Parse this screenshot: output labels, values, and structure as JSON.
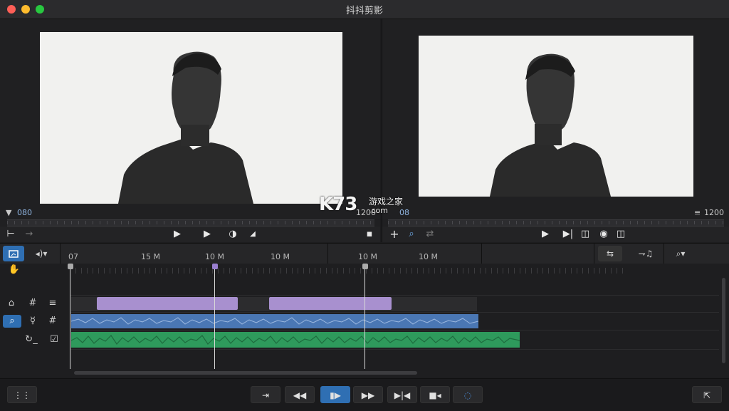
{
  "window": {
    "title": "抖抖剪影"
  },
  "viewer_left": {
    "timecode": "080",
    "label_right": "1200"
  },
  "viewer_right": {
    "timecode": "08",
    "zoom": "1200"
  },
  "watermark": {
    "logo": "K73",
    "name": "游戏之家",
    "url": ".com"
  },
  "ruler": {
    "labels": [
      "07",
      "15 M",
      "10 M",
      "10 M",
      "10 M",
      "10 M"
    ]
  },
  "colors": {
    "accent": "#2f6fb3",
    "purple_clip": "#a890cf",
    "audio_blue": "#4a77b4",
    "audio_green": "#2e9a5c",
    "playhead_purple": "#9a7fd0"
  }
}
